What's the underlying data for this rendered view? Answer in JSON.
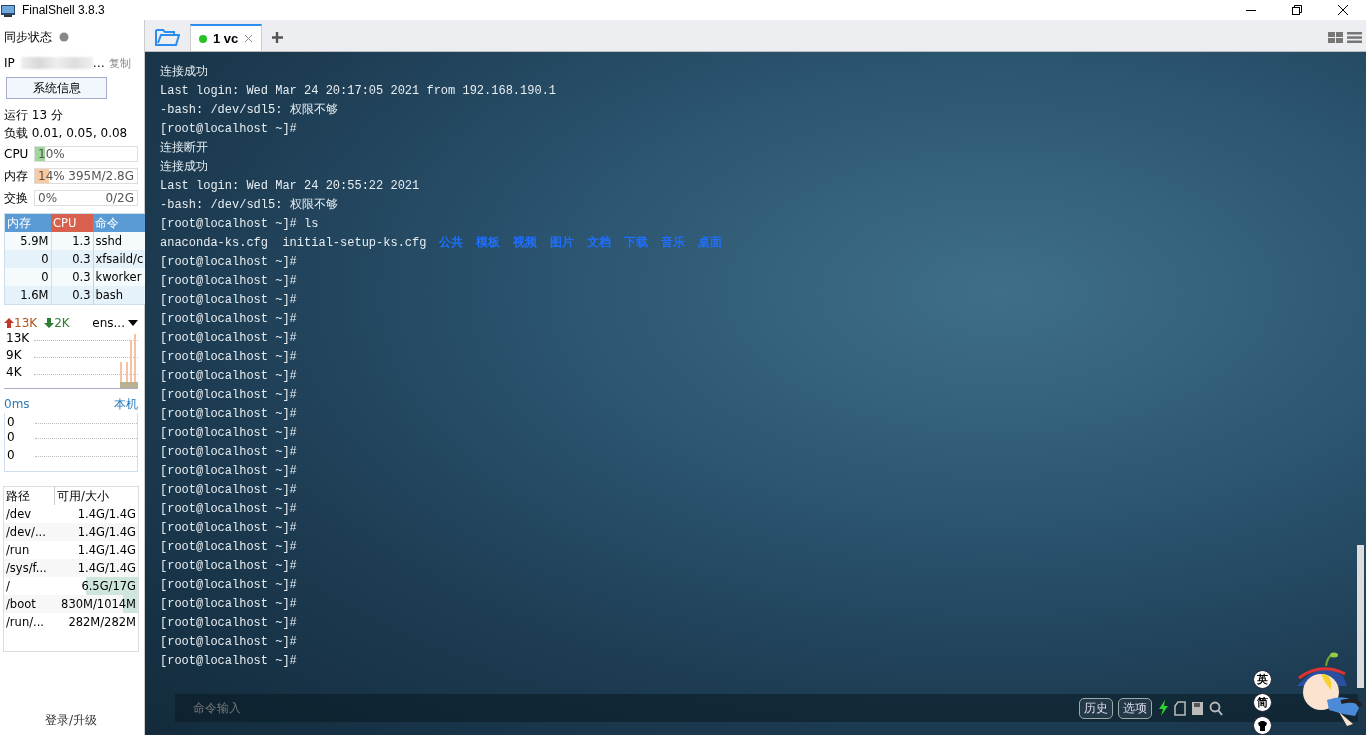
{
  "window": {
    "title": "FinalShell 3.8.3"
  },
  "sidebar": {
    "sync": {
      "label": "同步状态",
      "connected": false
    },
    "ip": {
      "label": "IP",
      "value": "…",
      "action": "复制"
    },
    "sysinfo_button": "系统信息",
    "uptime": "运行 13 分",
    "load": "负载 0.01, 0.05, 0.08",
    "meters": [
      {
        "label": "CPU",
        "kind": "cpu",
        "level": 0.1,
        "reading": "10%"
      },
      {
        "label": "内存",
        "kind": "mem",
        "level": 0.14,
        "reading": "14%",
        "detail": "395M/2.8G"
      },
      {
        "label": "交换",
        "kind": "swap",
        "level": 0,
        "reading": "0%",
        "detail": "0/2G"
      }
    ],
    "processes": {
      "columns": [
        "内存",
        "CPU",
        "命令"
      ],
      "rows": [
        {
          "mem": "5.9M",
          "cpu": "1.3",
          "cmd": "sshd"
        },
        {
          "mem": "0",
          "cpu": "0.3",
          "cmd": "xfsaild/c"
        },
        {
          "mem": "0",
          "cpu": "0.3",
          "cmd": "kworker"
        },
        {
          "mem": "1.6M",
          "cpu": "0.3",
          "cmd": "bash"
        }
      ]
    },
    "network": {
      "up": "13K",
      "down": "2K",
      "interface": "ens...",
      "ticks": [
        "13K",
        "9K",
        "4K"
      ]
    },
    "ping": {
      "latency": "0ms",
      "target": "本机",
      "ticks": [
        "0",
        "0",
        "0"
      ]
    },
    "disks": {
      "columns": [
        "路径",
        "可用/大小"
      ],
      "rows": [
        {
          "path": "/dev",
          "size": "1.4G/1.4G"
        },
        {
          "path": "/dev/...",
          "size": "1.4G/1.4G"
        },
        {
          "path": "/run",
          "size": "1.4G/1.4G"
        },
        {
          "path": "/sys/f...",
          "size": "1.4G/1.4G"
        },
        {
          "path": "/",
          "size": "6.5G/17G",
          "level": 0.62
        },
        {
          "path": "/boot",
          "size": "830M/1014M",
          "level": 0.18
        },
        {
          "path": "/run/...",
          "size": "282M/282M"
        }
      ]
    },
    "login": "登录/升级"
  },
  "tabs": [
    {
      "label": "1 vc",
      "selected": true,
      "connected": true
    }
  ],
  "terminal": {
    "lines": [
      {
        "kind": "text",
        "text": "连接成功"
      },
      {
        "kind": "text",
        "text": "Last login: Wed Mar 24 20:17:05 2021 from 192.168.190.1"
      },
      {
        "kind": "text",
        "text": "-bash: /dev/sdl5: 权限不够"
      },
      {
        "kind": "text",
        "text": "[root@localhost ~]#"
      },
      {
        "kind": "text",
        "text": "连接断开"
      },
      {
        "kind": "text",
        "text": "连接成功"
      },
      {
        "kind": "text",
        "text": "Last login: Wed Mar 24 20:55:22 2021"
      },
      {
        "kind": "text",
        "text": "-bash: /dev/sdl5: 权限不够"
      },
      {
        "kind": "text",
        "text": "[root@localhost ~]# ls"
      },
      {
        "kind": "listing",
        "files": [
          "anaconda-ks.cfg",
          "initial-setup-ks.cfg"
        ],
        "dirs": [
          "公共",
          "模板",
          "视频",
          "图片",
          "文档",
          "下载",
          "音乐",
          "桌面"
        ]
      },
      {
        "kind": "text",
        "text": "[root@localhost ~]#"
      },
      {
        "kind": "text",
        "text": "[root@localhost ~]#"
      },
      {
        "kind": "text",
        "text": "[root@localhost ~]#"
      },
      {
        "kind": "text",
        "text": "[root@localhost ~]#"
      },
      {
        "kind": "text",
        "text": "[root@localhost ~]#"
      },
      {
        "kind": "text",
        "text": "[root@localhost ~]#"
      },
      {
        "kind": "text",
        "text": "[root@localhost ~]#"
      },
      {
        "kind": "text",
        "text": "[root@localhost ~]#"
      },
      {
        "kind": "text",
        "text": "[root@localhost ~]#"
      },
      {
        "kind": "text",
        "text": "[root@localhost ~]#"
      },
      {
        "kind": "text",
        "text": "[root@localhost ~]#"
      },
      {
        "kind": "text",
        "text": "[root@localhost ~]#"
      },
      {
        "kind": "text",
        "text": "[root@localhost ~]#"
      },
      {
        "kind": "text",
        "text": "[root@localhost ~]#"
      },
      {
        "kind": "text",
        "text": "[root@localhost ~]#"
      },
      {
        "kind": "text",
        "text": "[root@localhost ~]#"
      },
      {
        "kind": "text",
        "text": "[root@localhost ~]#"
      },
      {
        "kind": "text",
        "text": "[root@localhost ~]#"
      },
      {
        "kind": "text",
        "text": "[root@localhost ~]#"
      },
      {
        "kind": "text",
        "text": "[root@localhost ~]#"
      },
      {
        "kind": "text",
        "text": "[root@localhost ~]#"
      },
      {
        "kind": "text",
        "text": "[root@localhost ~]#"
      }
    ]
  },
  "command_bar": {
    "placeholder": "命令输入",
    "buttons": [
      "历史",
      "选项"
    ]
  },
  "ime": {
    "buttons": [
      "英",
      "简"
    ]
  }
}
